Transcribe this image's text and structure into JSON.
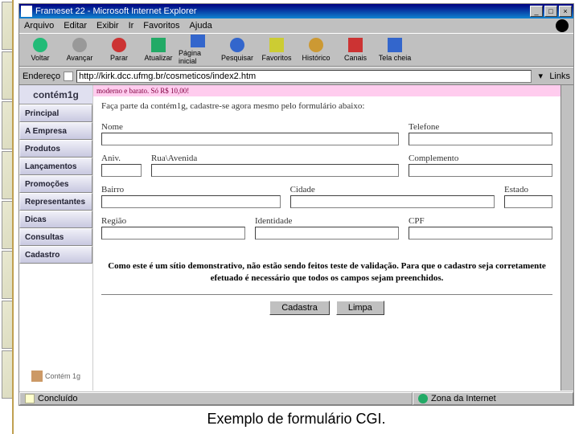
{
  "window": {
    "title": "Frameset 22 - Microsoft Internet Explorer",
    "menus": [
      "Arquivo",
      "Editar",
      "Exibir",
      "Ir",
      "Favoritos",
      "Ajuda"
    ],
    "toolbar": [
      {
        "label": "Voltar",
        "icon": "#2b7"
      },
      {
        "label": "Avançar",
        "icon": "#999"
      },
      {
        "label": "Parar",
        "icon": "#c33"
      },
      {
        "label": "Atualizar",
        "icon": "#2a6"
      },
      {
        "label": "Página inicial",
        "icon": "#36c"
      },
      {
        "label": "Pesquisar",
        "icon": "#36c"
      },
      {
        "label": "Favoritos",
        "icon": "#cc3"
      },
      {
        "label": "Histórico",
        "icon": "#c93"
      },
      {
        "label": "Canais",
        "icon": "#c33"
      },
      {
        "label": "Tela cheia",
        "icon": "#36c"
      }
    ],
    "address_label": "Endereço",
    "address_value": "http://kirk.dcc.ufmg.br/cosmeticos/index2.htm",
    "links_label": "Links",
    "status_left": "Concluído",
    "status_right": "Zona da Internet"
  },
  "site": {
    "brand": "contém1g",
    "nav": [
      "Principal",
      "A Empresa",
      "Produtos",
      "Lançamentos",
      "Promoções",
      "Representantes",
      "Dicas",
      "Consultas",
      "Cadastro"
    ],
    "footer": "Contém 1g",
    "topstrip": "moderno e barato. Só R$ 10,00!",
    "intro": "Faça parte da contém1g, cadastre-se agora mesmo pelo formulário abaixo:",
    "fields": {
      "nome": "Nome",
      "telefone": "Telefone",
      "aniv": "Aniv.",
      "rua": "Rua\\Avenida",
      "complemento": "Complemento",
      "bairro": "Bairro",
      "cidade": "Cidade",
      "estado": "Estado",
      "regiao": "Região",
      "identidade": "Identidade",
      "cpf": "CPF"
    },
    "note": "Como este é um sítio demonstrativo, não estão sendo feitos teste de validação. Para que o cadastro seja corretamente efetuado é necessário que todos os campos sejam preenchidos.",
    "btn_submit": "Cadastra",
    "btn_reset": "Limpa"
  },
  "caption": "Exemplo de formulário CGI."
}
